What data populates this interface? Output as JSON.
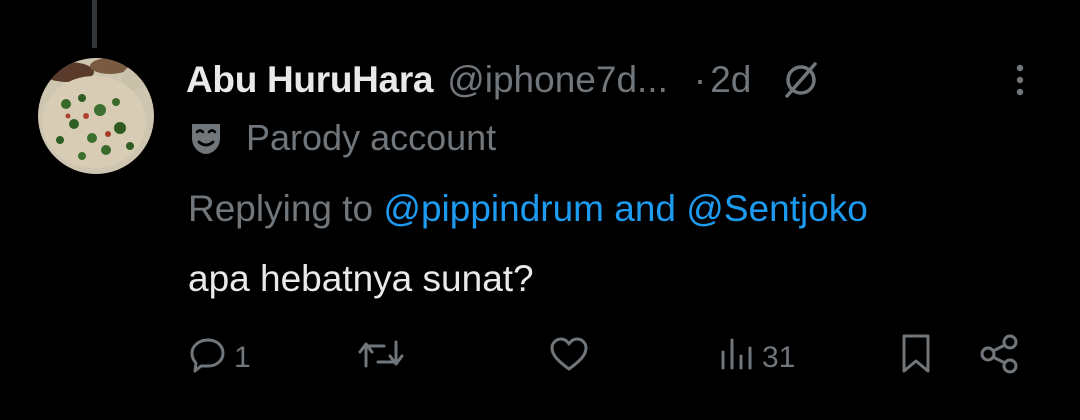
{
  "tweet": {
    "author_name": "Abu HuruHara",
    "author_handle": "@iphone7d...",
    "separator": "·",
    "timestamp": "2d",
    "account_label": "Parody account",
    "replying_prefix": "Replying to",
    "mention_1": "@pippindrum",
    "mention_joiner": "and",
    "mention_2": "@Sentjoko",
    "text": "apa hebatnya sunat?"
  },
  "actions": {
    "reply_count": "1",
    "retweet_count": "",
    "like_count": "",
    "views_count": "31"
  },
  "icons": {
    "verified": "circle-slash-icon",
    "more": "more-vertical-icon",
    "parody": "theater-mask-icon",
    "reply": "reply-bubble-icon",
    "retweet": "retweet-icon",
    "like": "heart-icon",
    "views": "bar-chart-icon",
    "bookmark": "bookmark-icon",
    "share": "share-icon"
  },
  "colors": {
    "background": "#000000",
    "primary_text": "#e7e9ea",
    "secondary_text": "#71767b",
    "accent": "#1d9bf0"
  }
}
